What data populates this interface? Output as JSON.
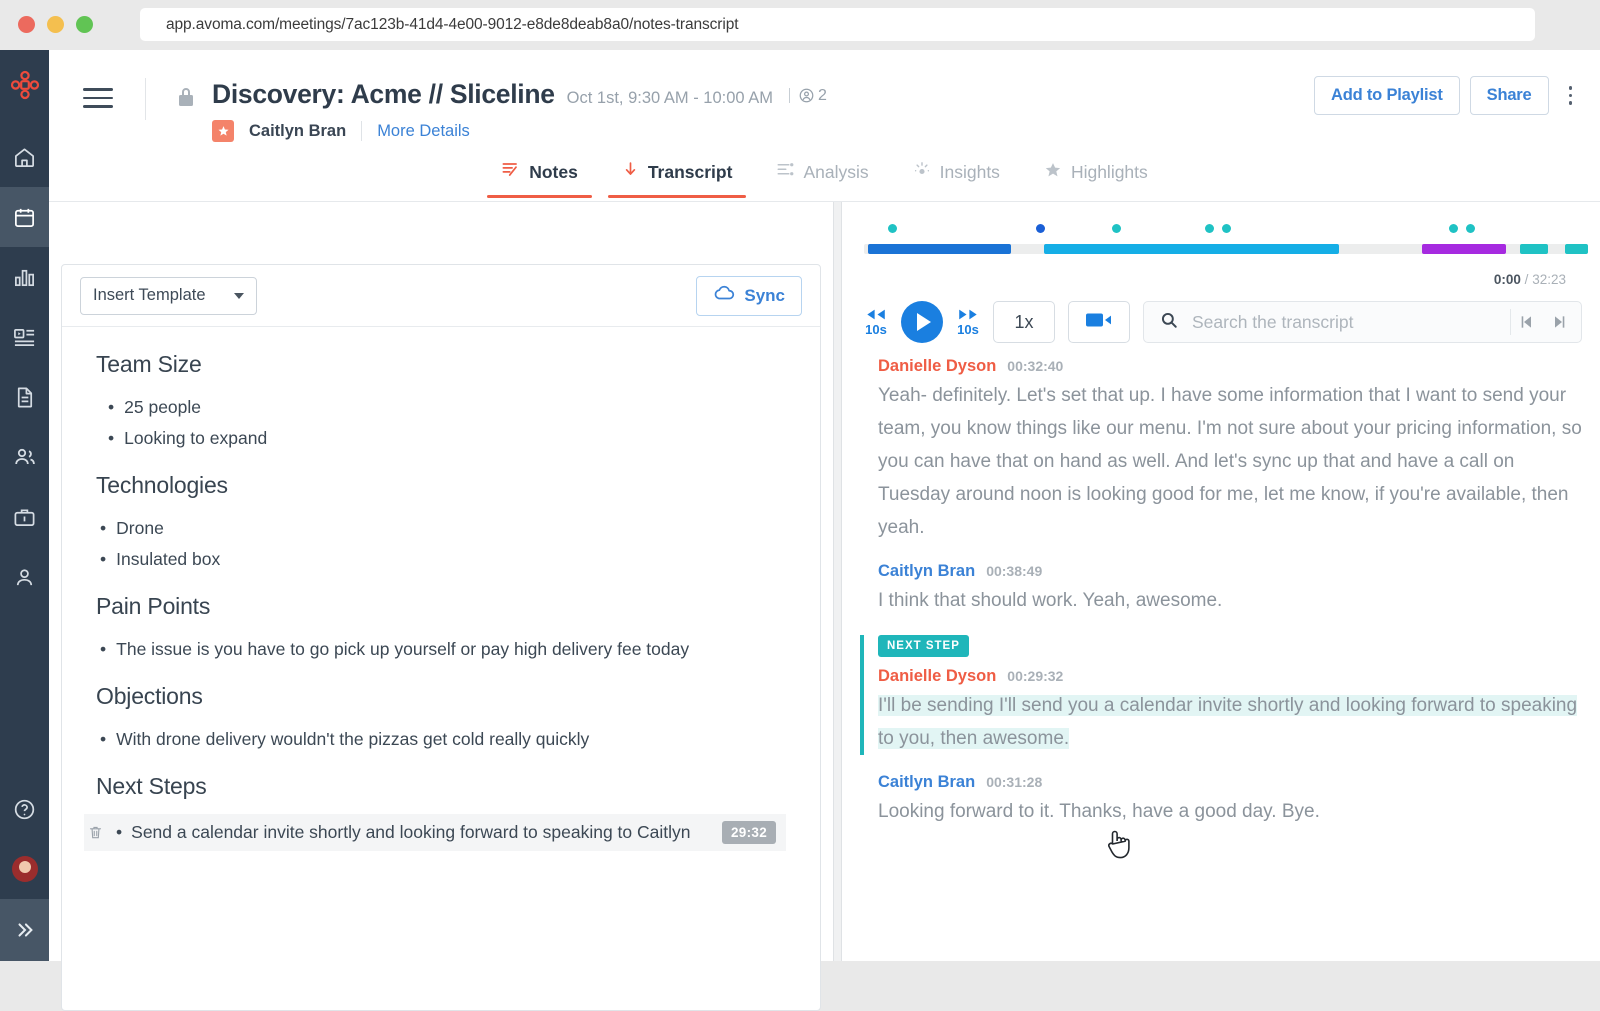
{
  "browser": {
    "url": "app.avoma.com/meetings/7ac123b-41d4-4e00-9012-e8de8deab8a0/notes-transcript"
  },
  "header": {
    "title": "Discovery: Acme // Sliceline",
    "datetime": "Oct 1st, 9:30 AM - 10:00 AM",
    "participant_count": "2",
    "host": "Caitlyn Bran",
    "more_details": "More Details",
    "add_to_playlist": "Add to Playlist",
    "share": "Share"
  },
  "tabs": [
    {
      "label": "Notes",
      "icon": "notes-icon",
      "active": true
    },
    {
      "label": "Transcript",
      "icon": "transcript-icon",
      "active": true
    },
    {
      "label": "Analysis",
      "icon": "analysis-icon",
      "active": false
    },
    {
      "label": "Insights",
      "icon": "insights-icon",
      "active": false
    },
    {
      "label": "Highlights",
      "icon": "star-icon",
      "active": false
    }
  ],
  "notes": {
    "insert_template": "Insert Template",
    "sync": "Sync",
    "sections": [
      {
        "heading": "Team Size",
        "items": [
          "25 people",
          "Looking to expand"
        ]
      },
      {
        "heading": "Technologies",
        "items": [
          "Drone",
          "Insulated box"
        ]
      },
      {
        "heading": "Pain Points",
        "items": [
          "The issue is you have to go pick up yourself or pay high delivery fee today"
        ]
      },
      {
        "heading": "Objections",
        "items": [
          "With drone delivery wouldn't the pizzas get cold really quickly"
        ]
      }
    ],
    "next_steps_heading": "Next Steps",
    "next_step": {
      "text": "Send a calendar invite shortly and looking forward to speaking to Caitlyn",
      "time": "29:32"
    }
  },
  "player": {
    "current_time": "0:00",
    "total_time": "32:23",
    "separator": "/",
    "speed": "1x",
    "skip_back_label": "10s",
    "skip_forward_label": "10s",
    "search_placeholder": "Search the transcript",
    "timeline": {
      "segments": [
        {
          "left_pct": 0.5,
          "width_pct": 20.5,
          "color": "#1a73d6"
        },
        {
          "left_pct": 25.6,
          "width_pct": 42.0,
          "color": "#15aee6"
        },
        {
          "left_pct": 79.5,
          "width_pct": 12.0,
          "color": "#a62ae0"
        },
        {
          "left_pct": 93.5,
          "width_pct": 4.0,
          "color": "#1fc2c4"
        },
        {
          "left_pct": 99.8,
          "width_pct": 3.4,
          "color": "#1fc2c4"
        }
      ],
      "markers": [
        {
          "left_pct": 3.4,
          "color": "#1fc2c4"
        },
        {
          "left_pct": 23.9,
          "color": "#1a5fd6"
        },
        {
          "left_pct": 34.6,
          "color": "#1fc2c4"
        },
        {
          "left_pct": 47.5,
          "color": "#1fc2c4"
        },
        {
          "left_pct": 49.9,
          "color": "#1fc2c4"
        },
        {
          "left_pct": 81.5,
          "color": "#1fc2c4"
        },
        {
          "left_pct": 83.9,
          "color": "#1fc2c4"
        }
      ]
    }
  },
  "transcript": [
    {
      "speaker": "Danielle Dyson",
      "speaker_color": "red",
      "time": "00:32:40",
      "text": "Yeah- definitely. Let's set that up. I have some information that I want to send your team, you know things like our menu. I'm not sure about your pricing information, so you can have that on hand as well. And let's sync up that and have a call on Tuesday around noon is looking good for me, let me know, if you're available, then yeah.",
      "flagged": false,
      "tag": null,
      "highlighted": false
    },
    {
      "speaker": "Caitlyn Bran",
      "speaker_color": "blue",
      "time": "00:38:49",
      "text": "I think that should work. Yeah, awesome.",
      "flagged": false,
      "tag": null,
      "highlighted": false
    },
    {
      "speaker": "Danielle Dyson",
      "speaker_color": "red",
      "time": "00:29:32",
      "text": "I'll be sending I'll send you a calendar invite shortly and looking forward to speaking to you, then awesome.",
      "flagged": true,
      "tag": "NEXT STEP",
      "highlighted": true
    },
    {
      "speaker": "Caitlyn Bran",
      "speaker_color": "blue",
      "time": "00:31:28",
      "text": "Looking forward to it. Thanks, have a good day. Bye.",
      "flagged": false,
      "tag": null,
      "highlighted": false
    }
  ],
  "sidebar": {
    "items": [
      {
        "name": "home",
        "active": false
      },
      {
        "name": "calendar",
        "active": true
      },
      {
        "name": "analytics",
        "active": false
      },
      {
        "name": "playlist",
        "active": false
      },
      {
        "name": "documents",
        "active": false
      },
      {
        "name": "teams",
        "active": false
      },
      {
        "name": "deals",
        "active": false
      },
      {
        "name": "contacts",
        "active": false
      }
    ],
    "help": "help",
    "expand": "expand"
  },
  "colors": {
    "brand_red": "#ef5d45",
    "accent_blue": "#3b82d6",
    "rail_bg": "#2e3d4e",
    "teal": "#1fb6ba"
  }
}
